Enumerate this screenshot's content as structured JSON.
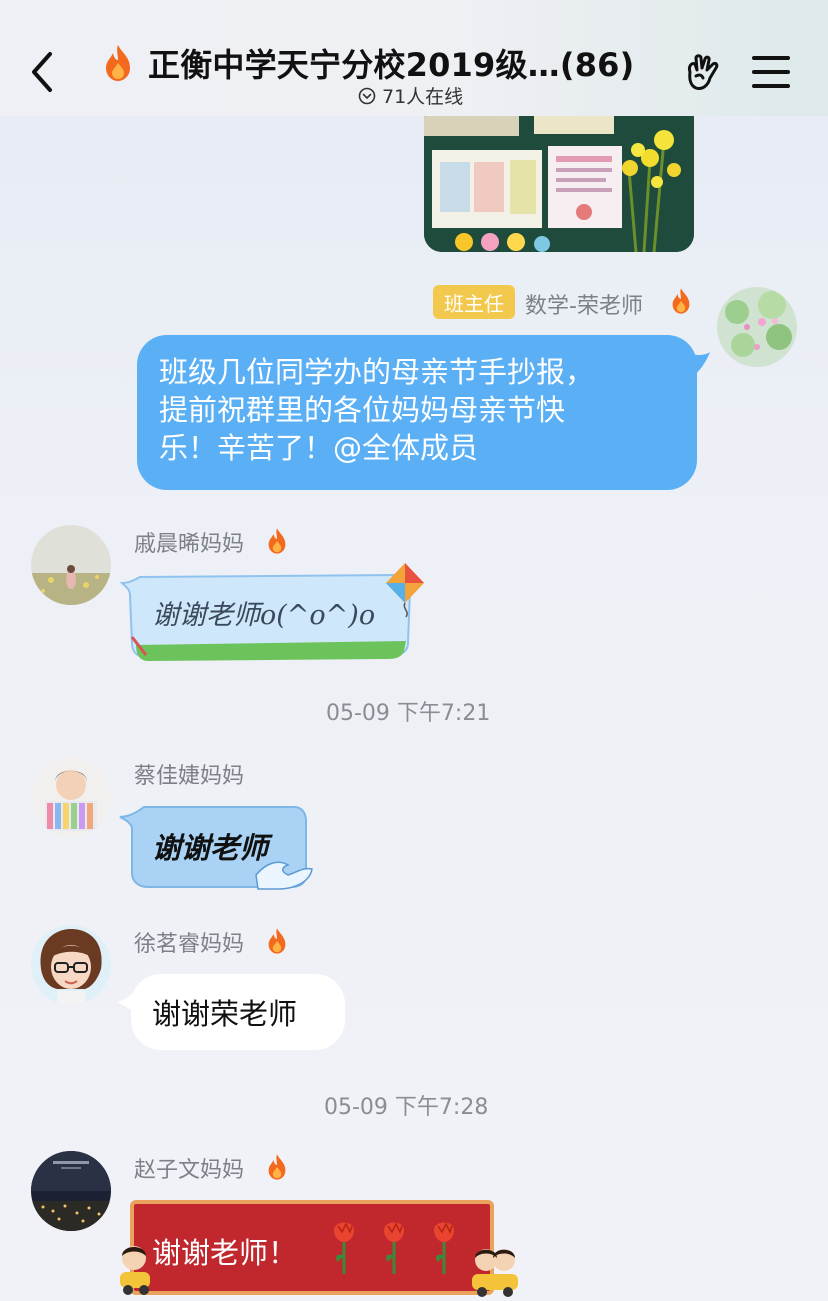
{
  "header": {
    "title": "正衡中学天宁分校2019级…(86)",
    "online_status": "71人在线"
  },
  "messages": [
    {
      "sender": "数学-荣老师",
      "badge": "班主任",
      "text": "班级几位同学办的母亲节手抄报，提前祝群里的各位妈妈母亲节快乐！辛苦了！@全体成员",
      "lines": [
        "班级几位同学办的母亲节手抄报，",
        "提前祝群里的各位妈妈母亲节快",
        "乐！辛苦了！@全体成员"
      ]
    },
    {
      "sender": "戚晨晞妈妈",
      "text": "谢谢老师o(^o^)o"
    },
    {
      "sender": "蔡佳婕妈妈",
      "text": "谢谢老师"
    },
    {
      "sender": "徐茗睿妈妈",
      "text": "谢谢荣老师"
    },
    {
      "sender": "赵子文妈妈",
      "text": "谢谢老师！"
    }
  ],
  "timestamps": [
    "05-09 下午7:21",
    "05-09 下午7:28"
  ],
  "colors": {
    "self_bubble": "#5aaff5",
    "badge": "#f2c94c",
    "fire": "#f36a1e",
    "red_bubble": "#c0282e"
  },
  "icons": [
    "back-arrow-icon",
    "fire-icon",
    "chevron-circle-icon",
    "hand-gesture-icon",
    "menu-icon",
    "rose-icon",
    "kite-icon"
  ]
}
